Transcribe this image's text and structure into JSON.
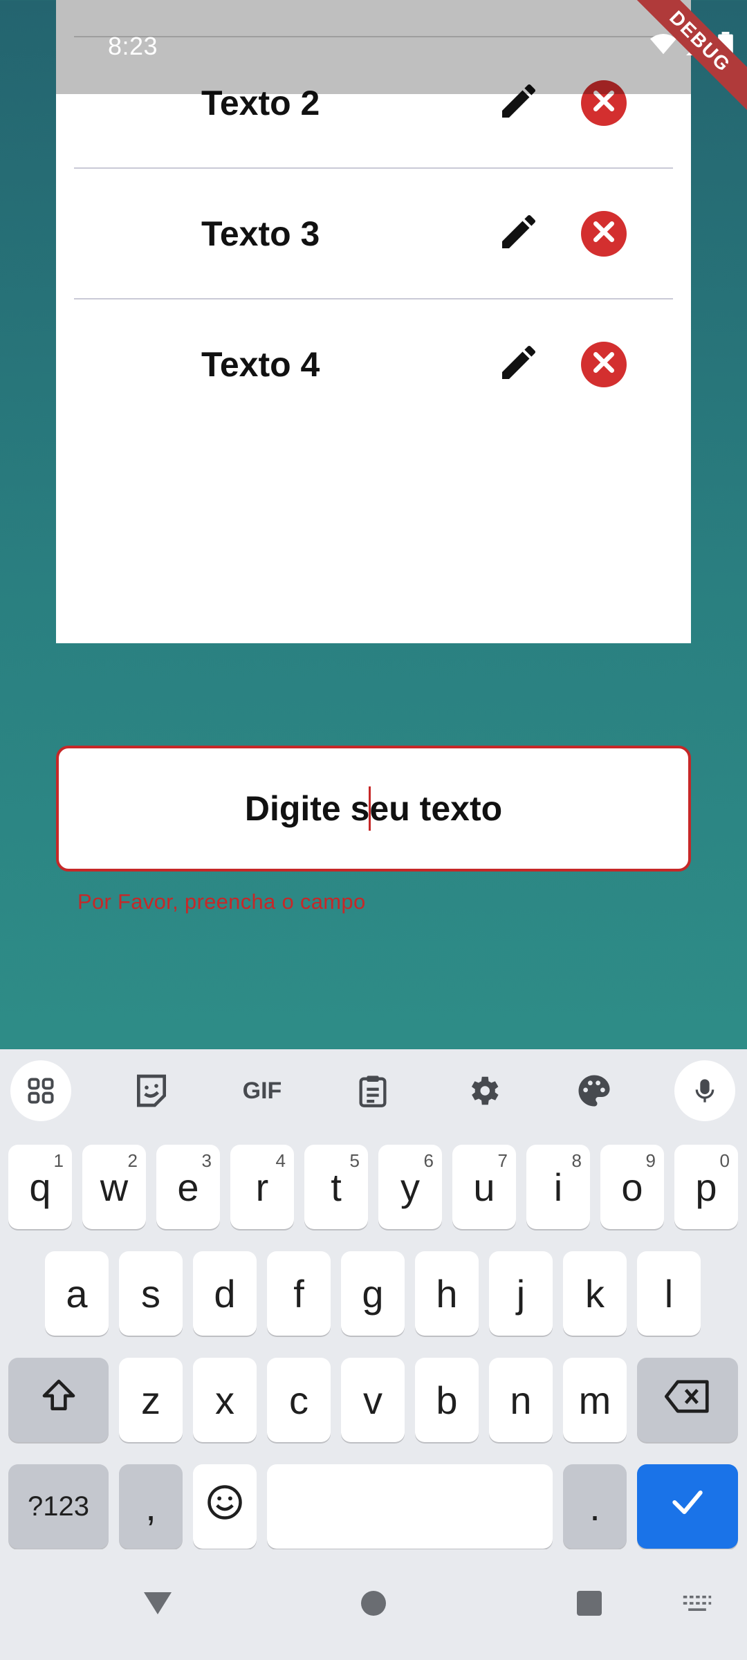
{
  "status_bar": {
    "time": "8:23",
    "debug_label": "DEBUG",
    "icons": [
      "wifi-icon",
      "signal-icon",
      "battery-icon"
    ]
  },
  "list": {
    "items": [
      {
        "label": "Texto 2"
      },
      {
        "label": "Texto 3"
      },
      {
        "label": "Texto 4"
      }
    ],
    "edit_icon": "pencil-icon",
    "delete_icon": "close-circle-icon",
    "delete_color": "#d32f2f"
  },
  "input": {
    "value": "Digite seu texto",
    "error": "Por Favor, preencha o campo",
    "error_color": "#c62828"
  },
  "keyboard": {
    "toolbar": [
      "apps-icon",
      "sticker-icon",
      "GIF",
      "clipboard-icon",
      "settings-icon",
      "palette-icon",
      "mic-icon"
    ],
    "gif_label": "GIF",
    "row1": [
      {
        "key": "q",
        "hint": "1"
      },
      {
        "key": "w",
        "hint": "2"
      },
      {
        "key": "e",
        "hint": "3"
      },
      {
        "key": "r",
        "hint": "4"
      },
      {
        "key": "t",
        "hint": "5"
      },
      {
        "key": "y",
        "hint": "6"
      },
      {
        "key": "u",
        "hint": "7"
      },
      {
        "key": "i",
        "hint": "8"
      },
      {
        "key": "o",
        "hint": "9"
      },
      {
        "key": "p",
        "hint": "0"
      }
    ],
    "row2": [
      "a",
      "s",
      "d",
      "f",
      "g",
      "h",
      "j",
      "k",
      "l"
    ],
    "row3": [
      "z",
      "x",
      "c",
      "v",
      "b",
      "n",
      "m"
    ],
    "symbols_label": "?123",
    "comma_label": ",",
    "period_label": ".",
    "enter_color": "#1a73e8"
  }
}
